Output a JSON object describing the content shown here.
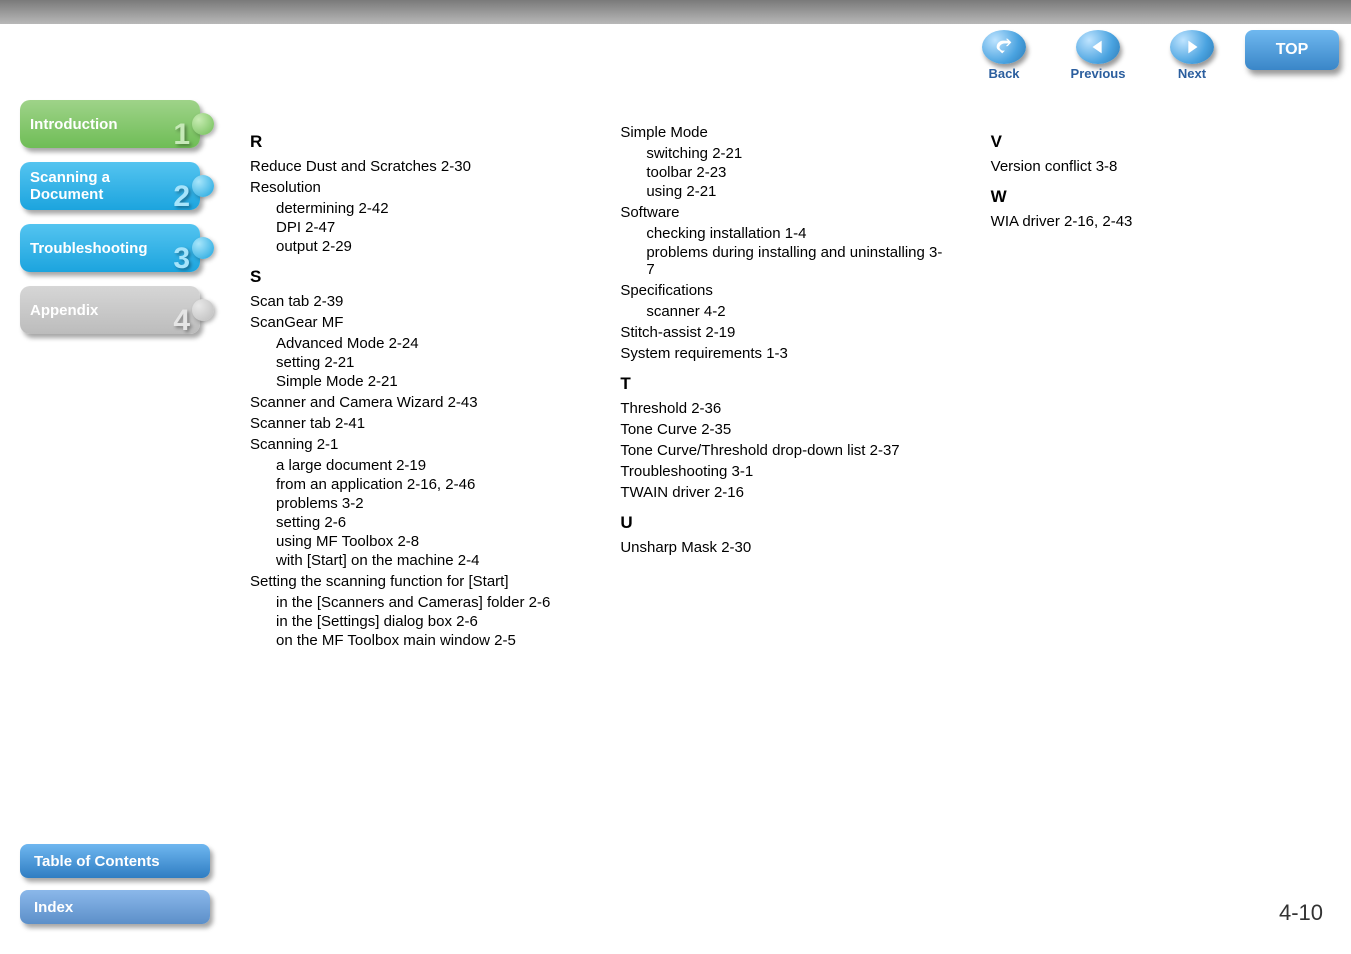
{
  "nav": {
    "back": "Back",
    "previous": "Previous",
    "next": "Next",
    "top": "TOP"
  },
  "sidebar": {
    "items": [
      {
        "label": "Introduction",
        "num": "1"
      },
      {
        "label": "Scanning a\nDocument",
        "num": "2"
      },
      {
        "label": "Troubleshooting",
        "num": "3"
      },
      {
        "label": "Appendix",
        "num": "4"
      }
    ]
  },
  "bottom": {
    "toc": "Table of Contents",
    "index": "Index"
  },
  "page_number": "4-10",
  "index": {
    "col1": {
      "R": {
        "heading": "R",
        "e1": "Reduce Dust and Scratches 2-30",
        "e2": "Resolution",
        "e2a": "determining 2-42",
        "e2b": "DPI 2-47",
        "e2c": "output 2-29"
      },
      "S": {
        "heading": "S",
        "e1": "Scan tab 2-39",
        "e2": "ScanGear MF",
        "e2a": "Advanced Mode 2-24",
        "e2b": "setting 2-21",
        "e2c": "Simple Mode 2-21",
        "e3": "Scanner and Camera Wizard 2-43",
        "e4": "Scanner tab 2-41",
        "e5": "Scanning 2-1",
        "e5a": "a large document 2-19",
        "e5b": "from an application 2-16, 2-46",
        "e5c": "problems 3-2",
        "e5d": "setting 2-6",
        "e5e": "using MF Toolbox 2-8",
        "e5f": "with [Start] on the machine 2-4",
        "e6": "Setting the scanning function for [Start]",
        "e6a": "in the [Scanners and Cameras] folder 2-6",
        "e6b": "in the [Settings] dialog box 2-6",
        "e6c": "on the MF Toolbox main window 2-5"
      }
    },
    "col2": {
      "Scont": {
        "e1": "Simple Mode",
        "e1a": "switching 2-21",
        "e1b": "toolbar 2-23",
        "e1c": "using 2-21",
        "e2": "Software",
        "e2a": "checking installation 1-4",
        "e2b": "problems during installing and uninstalling 3-7",
        "e3": "Specifications",
        "e3a": "scanner 4-2",
        "e4": "Stitch-assist 2-19",
        "e5": "System requirements 1-3"
      },
      "T": {
        "heading": "T",
        "e1": "Threshold 2-36",
        "e2": "Tone Curve 2-35",
        "e3": "Tone Curve/Threshold drop-down list 2-37",
        "e4": "Troubleshooting 3-1",
        "e5": "TWAIN driver 2-16"
      },
      "U": {
        "heading": "U",
        "e1": "Unsharp Mask 2-30"
      }
    },
    "col3": {
      "V": {
        "heading": "V",
        "e1": "Version conflict 3-8"
      },
      "W": {
        "heading": "W",
        "e1": "WIA driver 2-16, 2-43"
      }
    }
  }
}
